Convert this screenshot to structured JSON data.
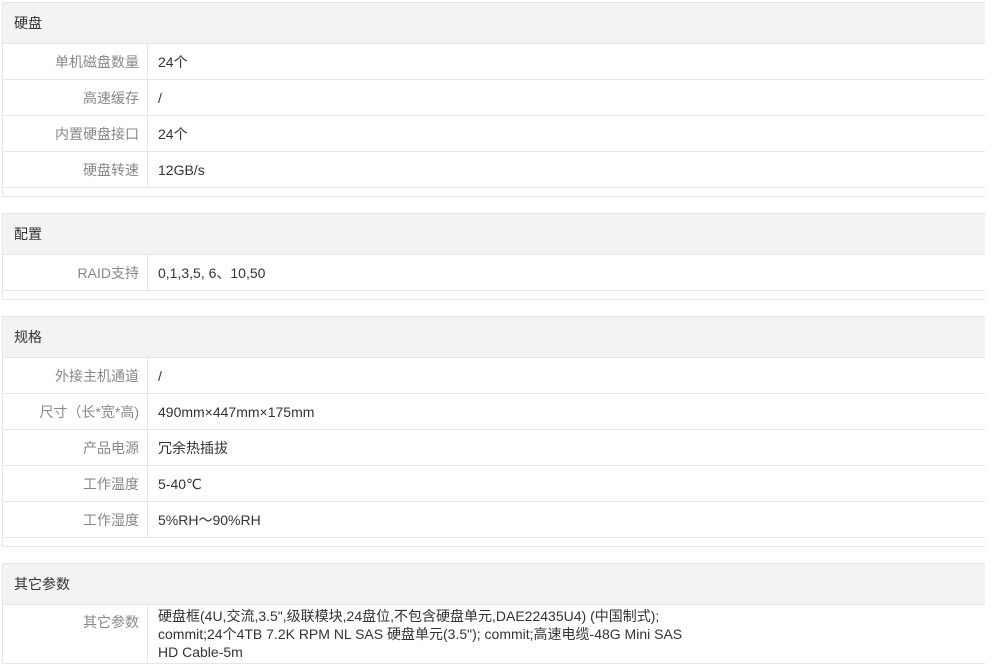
{
  "sections": [
    {
      "title": "硬盘",
      "rows": [
        {
          "label": "单机磁盘数量",
          "value": "24个"
        },
        {
          "label": "高速缓存",
          "value": "/"
        },
        {
          "label": "内置硬盘接口",
          "value": "24个"
        },
        {
          "label": "硬盘转速",
          "value": "12GB/s"
        }
      ]
    },
    {
      "title": "配置",
      "rows": [
        {
          "label": "RAID支持",
          "value": "0,1,3,5, 6、10,50"
        }
      ]
    },
    {
      "title": "规格",
      "rows": [
        {
          "label": "外接主机通道",
          "value": "/"
        },
        {
          "label": "尺寸（长*宽*高)",
          "value": "490mm×447mm×175mm"
        },
        {
          "label": "产品电源",
          "value": "冗余热插拔"
        },
        {
          "label": "工作温度",
          "value": "5-40℃"
        },
        {
          "label": "工作湿度",
          "value": "5%RH～90%RH"
        }
      ]
    },
    {
      "title": "其它参数",
      "rows": [
        {
          "label": "其它参数",
          "value": "硬盘框(4U,交流,3.5\",级联模块,24盘位,不包含硬盘单元,DAE22435U4) (中国制式);\ncommit;24个4TB 7.2K RPM NL SAS 硬盘单元(3.5\"); commit;高速电缆-48G Mini SAS\nHD Cable-5m"
        }
      ]
    }
  ]
}
